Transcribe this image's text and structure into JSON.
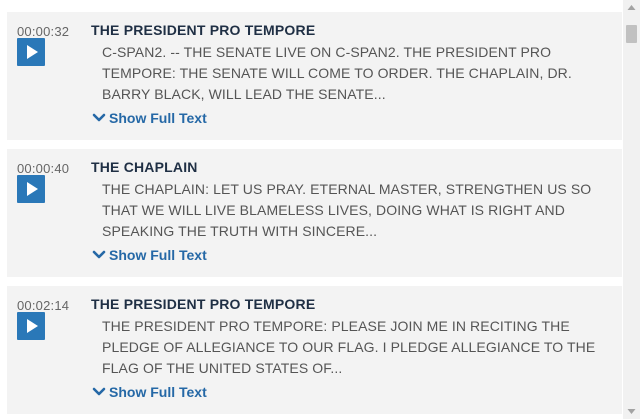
{
  "entries": [
    {
      "timestamp": "00:00:32",
      "speaker": "THE PRESIDENT PRO TEMPORE",
      "text": "C-SPAN2. -- THE SENATE LIVE ON C-SPAN2. THE PRESIDENT PRO TEMPORE: THE SENATE WILL COME TO ORDER. THE CHAPLAIN, DR. BARRY BLACK, WILL LEAD THE SENATE...",
      "show_full_label": "Show Full Text"
    },
    {
      "timestamp": "00:00:40",
      "speaker": "THE CHAPLAIN",
      "text": "THE CHAPLAIN: LET US PRAY. ETERNAL MASTER, STRENGTHEN US SO THAT WE WILL LIVE BLAMELESS LIVES, DOING WHAT IS RIGHT AND SPEAKING THE TRUTH WITH SINCERE...",
      "show_full_label": "Show Full Text"
    },
    {
      "timestamp": "00:02:14",
      "speaker": "THE PRESIDENT PRO TEMPORE",
      "text": "THE PRESIDENT PRO TEMPORE: PLEASE JOIN ME IN RECITING THE PLEDGE OF ALLEGIANCE TO OUR FLAG. I PLEDGE ALLEGIANCE TO THE FLAG OF THE UNITED STATES OF...",
      "show_full_label": "Show Full Text"
    }
  ],
  "icons": {
    "play": "play-icon",
    "expand": "chevron-down-icon",
    "scroll_up": "scroll-up-arrow-icon",
    "scroll_down": "scroll-down-arrow-icon"
  },
  "colors": {
    "accent": "#2a78b8",
    "link": "#2568a6",
    "speaker": "#1f2f44",
    "entry_background": "#f3f3f3"
  }
}
